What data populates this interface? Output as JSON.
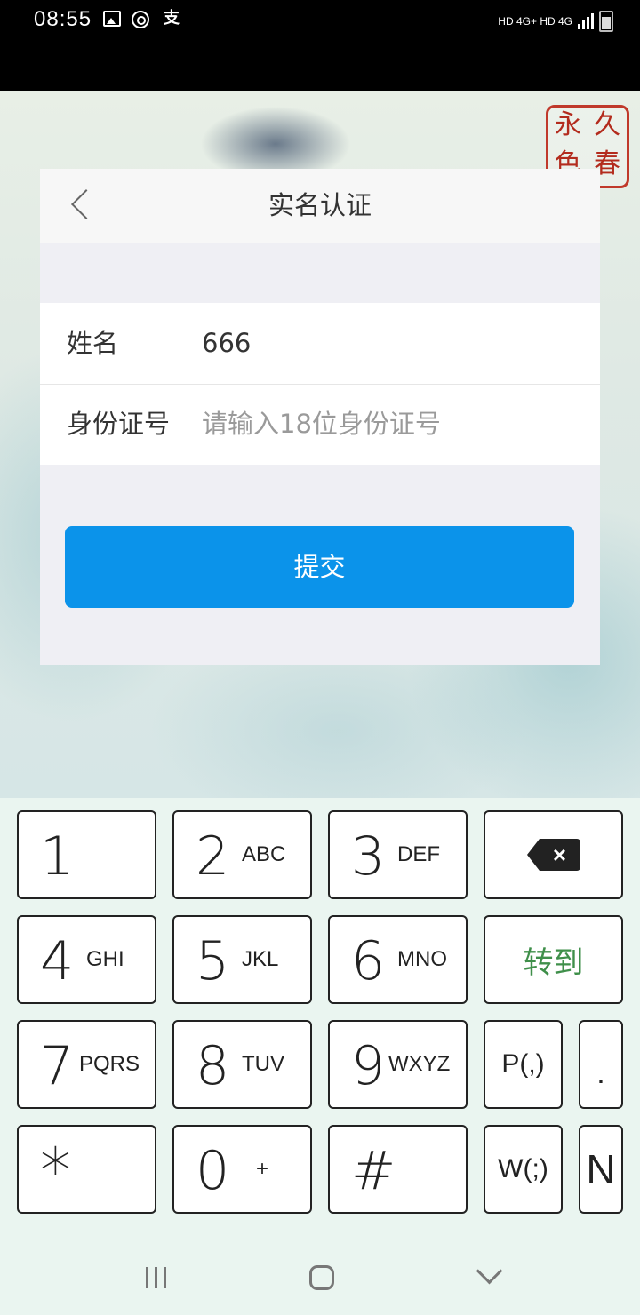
{
  "status_bar": {
    "time": "08:55",
    "icons": [
      "gallery-icon",
      "swirl-icon",
      "alipay-icon"
    ],
    "pay_glyph": "支",
    "right_text": "HD 4G+ HD 4G"
  },
  "seal_text": [
    "久",
    "永",
    "春",
    "色"
  ],
  "dialog": {
    "title": "实名认证",
    "name_label": "姓名",
    "name_value": "666",
    "id_label": "身份证号",
    "id_placeholder": "请输入18位身份证号",
    "submit_label": "提交"
  },
  "keyboard": {
    "keys": [
      {
        "main": "1",
        "sub": ""
      },
      {
        "main": "2",
        "sub": "ABC"
      },
      {
        "main": "3",
        "sub": "DEF"
      },
      {
        "main": "4",
        "sub": "GHI"
      },
      {
        "main": "5",
        "sub": "JKL"
      },
      {
        "main": "6",
        "sub": "MNO"
      },
      {
        "main": "7",
        "sub": "PQRS"
      },
      {
        "main": "8",
        "sub": "TUV"
      },
      {
        "main": "9",
        "sub": "WXYZ"
      },
      {
        "main": "*",
        "sub": ""
      },
      {
        "main": "0",
        "sub": "+"
      },
      {
        "main": "#",
        "sub": ""
      }
    ],
    "goto_label": "转到",
    "pause_label": "P(,)",
    "dot_label": ".",
    "wait_label": "W(;)",
    "n_label": "N",
    "accent_color": "#3f8f4a"
  },
  "navbar": {
    "icons": [
      "recent-apps-icon",
      "home-icon",
      "back-chevron-icon"
    ]
  }
}
